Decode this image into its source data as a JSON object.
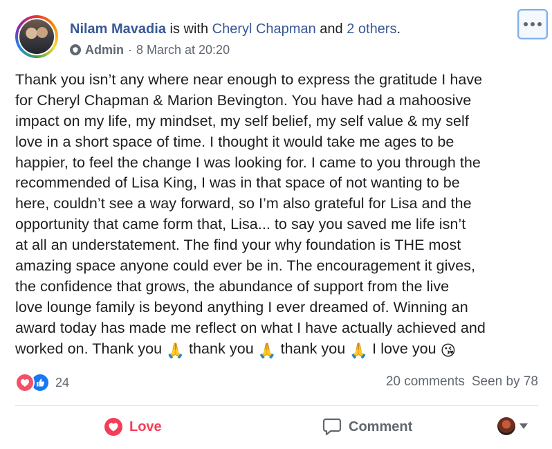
{
  "header": {
    "author": "Nilam Mavadia",
    "with_text": " is with ",
    "tagged": "Cheryl Chapman",
    "and_text": " and ",
    "others": "2 others",
    "period": ".",
    "role": "Admin",
    "separator": "·",
    "timestamp": "8 March at 20:20"
  },
  "post": {
    "lines": [
      "Thank you isn’t any where near enough to express the gratitude I have",
      "for Cheryl Chapman & Marion Bevington. You have had a mahoosive",
      "impact on my life, my mindset, my self belief, my self value & my self",
      "love in a short space of time. I thought it would take me ages to be",
      "happier, to feel the change I was looking for. I came to you through the",
      "recommended of Lisa King, I was in that space of not wanting to be",
      "here, couldn’t see a way forward, so I’m also grateful for Lisa and the",
      "opportunity that came form that, Lisa... to say you saved me life isn’t",
      "at all an understatement. The find your why foundation is THE most",
      "amazing space anyone could ever be in. The encouragement it gives,",
      "the confidence that grows, the abundance of support from the live",
      "love lounge family is beyond anything I ever dreamed of. Winning an",
      "award today has made me reflect on what I have actually achieved and"
    ],
    "last_line": {
      "part1": "worked on. Thank you ",
      "part2": " thank you ",
      "part3": " thank you ",
      "part4": " I love you "
    },
    "emoji_pray": "🙏",
    "emoji_kiss": "😘"
  },
  "reactions": {
    "count": "24",
    "types": [
      "love-icon",
      "like-icon"
    ]
  },
  "stats": {
    "comments": "20 comments",
    "seen": "Seen by 78"
  },
  "actions": {
    "love_label": "Love",
    "comment_label": "Comment"
  },
  "colors": {
    "link": "#385898",
    "love": "#f33e58",
    "like": "#1877f2",
    "secondary_text": "#606770",
    "highlight_border": "#7fb0ee"
  }
}
